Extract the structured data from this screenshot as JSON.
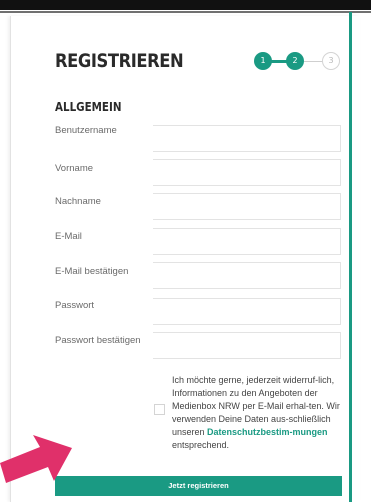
{
  "header": {
    "title": "REGISTRIEREN",
    "steps": [
      "1",
      "2",
      "3"
    ],
    "current_step": 2
  },
  "section": {
    "title": "ALLGEMEIN"
  },
  "fields": [
    {
      "label": "Benutzername",
      "value": ""
    },
    {
      "label": "Vorname",
      "value": ""
    },
    {
      "label": "Nachname",
      "value": ""
    },
    {
      "label": "E-Mail",
      "value": ""
    },
    {
      "label": "E-Mail bestätigen",
      "value": ""
    },
    {
      "label": "Passwort",
      "value": ""
    },
    {
      "label": "Passwort bestätigen",
      "value": ""
    }
  ],
  "consent": {
    "checked": false,
    "text_before": "Ich möchte gerne, jederzeit widerruf-lich, Informationen zu den Angeboten der Medienbox NRW per E-Mail erhal-ten. Wir verwenden Deine Daten aus-schließlich unseren ",
    "link_text": "Datenschutzbestim-mungen",
    "text_after": " entsprechend."
  },
  "submit": {
    "label": "Jetzt registrieren"
  },
  "colors": {
    "accent": "#1a9a83",
    "annotation_arrow": "#e0306a",
    "top_bar": "#111111"
  }
}
